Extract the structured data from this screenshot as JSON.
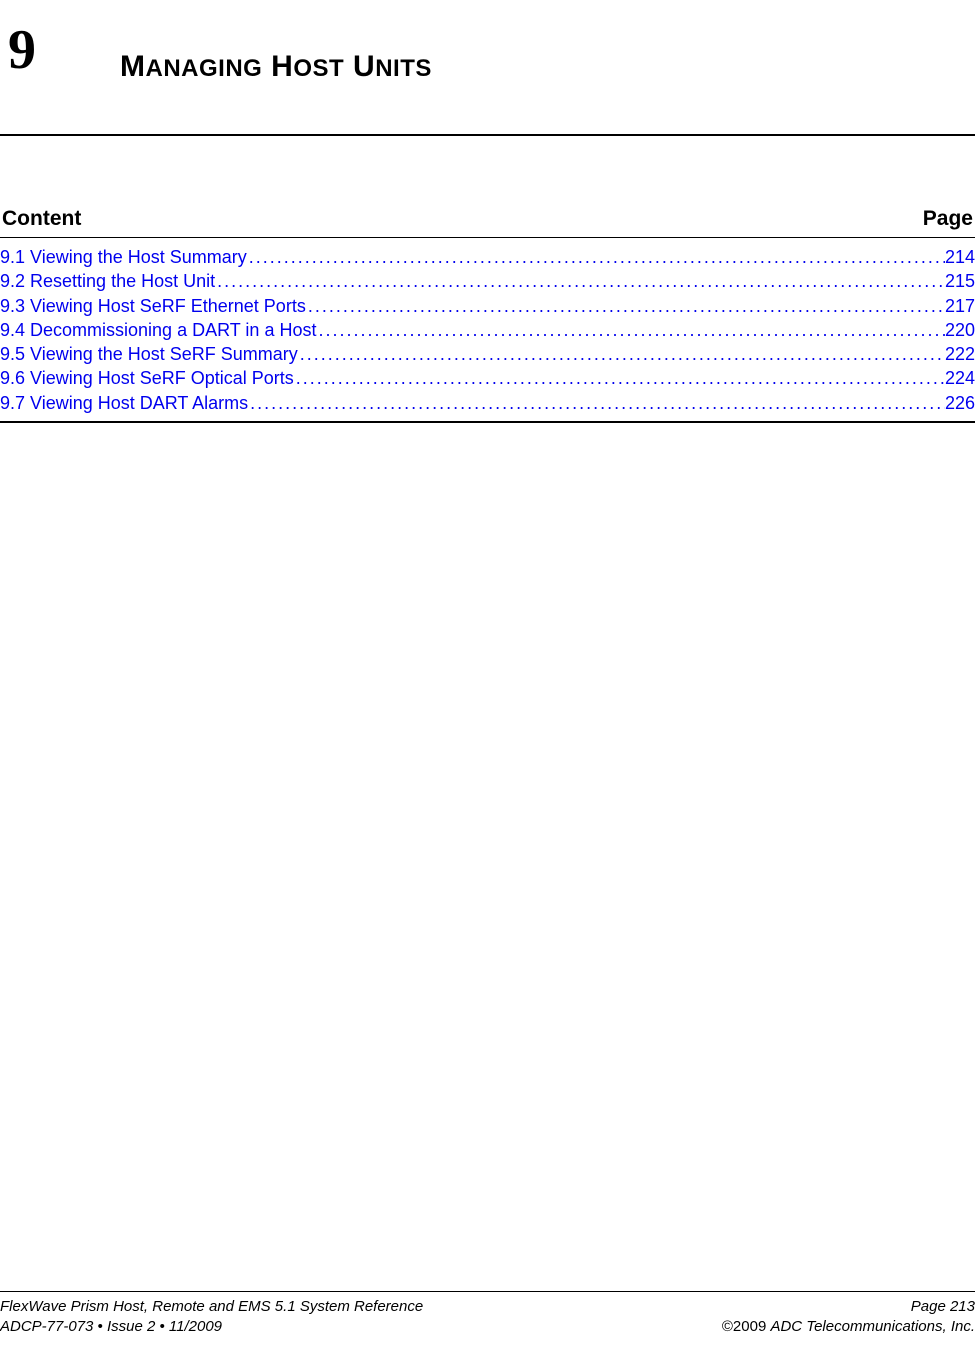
{
  "chapter": {
    "number": "9",
    "title_caps": [
      "M",
      " H",
      " U"
    ],
    "title_small": [
      "ANAGING",
      "OST",
      "NITS"
    ]
  },
  "toc": {
    "header_content": "Content",
    "header_page": "Page",
    "items": [
      {
        "title": "9.1 Viewing the Host Summary",
        "page": "214"
      },
      {
        "title": "9.2 Resetting the Host Unit ",
        "page": "215"
      },
      {
        "title": "9.3 Viewing Host SeRF Ethernet Ports",
        "page": "217"
      },
      {
        "title": "9.4 Decommissioning a DART in a Host",
        "page": "220"
      },
      {
        "title": "9.5 Viewing the Host SeRF Summary",
        "page": "222"
      },
      {
        "title": "9.6 Viewing Host SeRF Optical Ports ",
        "page": "224"
      },
      {
        "title": "9.7 Viewing Host DART Alarms ",
        "page": "226"
      }
    ]
  },
  "footer": {
    "left_line1": "FlexWave Prism Host, Remote and EMS 5.1 System Reference",
    "left_line2": "ADCP-77-073   •   Issue 2   •   11/2009",
    "right_line1": "Page 213",
    "right_line2_prefix": "©2009 ",
    "right_line2_italic": "ADC Telecommunications, Inc."
  }
}
